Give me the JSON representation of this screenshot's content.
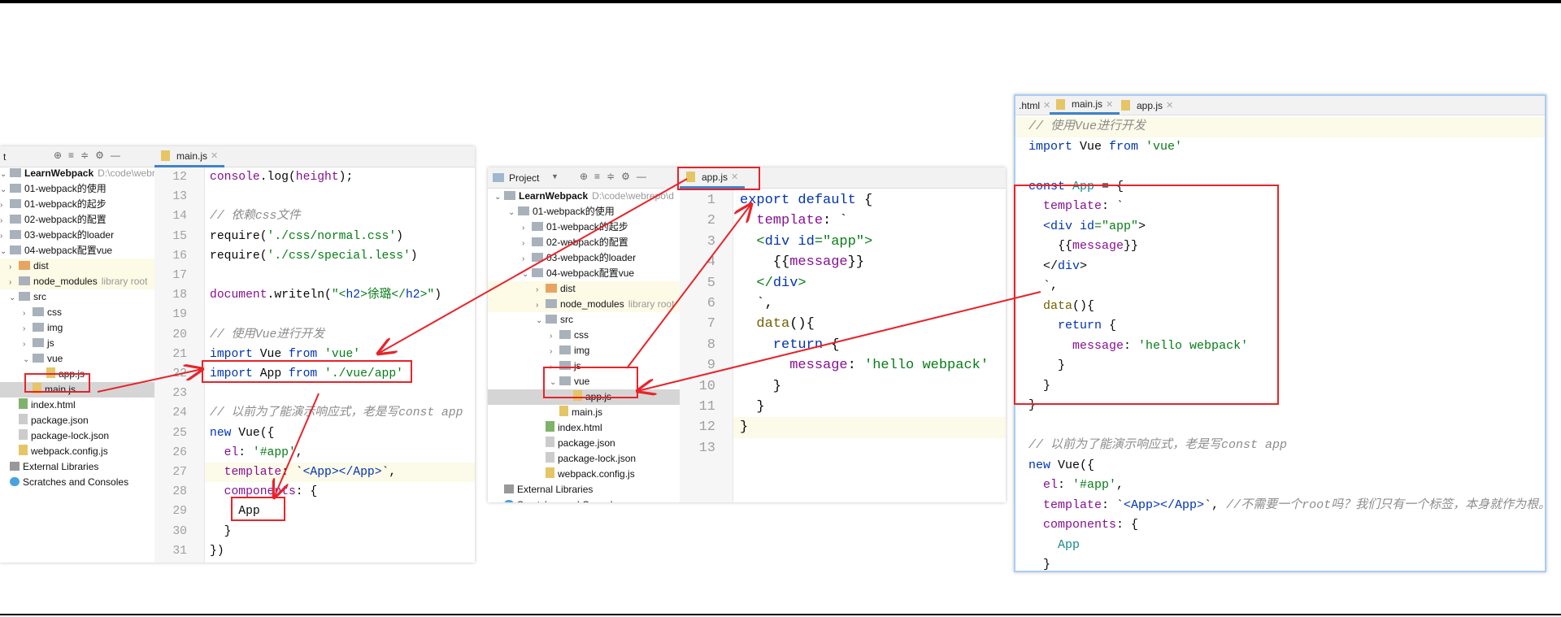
{
  "colors": {
    "annotation": "#e8232a",
    "keyword": "#0033b3",
    "string": "#067d17",
    "property": "#871094",
    "comment": "#8c8c8c"
  },
  "panel1": {
    "toolbar_label": "t",
    "tab": "main.js",
    "tree": [
      {
        "label": "LearnWebpack",
        "extra": "D:\\code\\webrepo\\d",
        "d": 0,
        "a": "v",
        "i": "folder",
        "bold": true
      },
      {
        "label": "01-webpack的使用",
        "d": 1,
        "a": "v",
        "i": "folder"
      },
      {
        "label": "01-webpack的起步",
        "d": 2,
        "a": ">",
        "i": "folder"
      },
      {
        "label": "02-webpack的配置",
        "d": 2,
        "a": ">",
        "i": "folder"
      },
      {
        "label": "03-webpack的loader",
        "d": 2,
        "a": ">",
        "i": "folder"
      },
      {
        "label": "04-webpack配置vue",
        "d": 2,
        "a": "v",
        "i": "folder"
      },
      {
        "label": "dist",
        "d": 3,
        "a": ">",
        "i": "orange",
        "hl": true
      },
      {
        "label": "node_modules",
        "extra": "library root",
        "d": 3,
        "a": ">",
        "i": "folder",
        "hl": true
      },
      {
        "label": "src",
        "d": 3,
        "a": "v",
        "i": "folder"
      },
      {
        "label": "css",
        "d": 4,
        "a": ">",
        "i": "folder"
      },
      {
        "label": "img",
        "d": 4,
        "a": ">",
        "i": "folder"
      },
      {
        "label": "js",
        "d": 4,
        "a": ">",
        "i": "folder"
      },
      {
        "label": "vue",
        "d": 4,
        "a": "v",
        "i": "folder"
      },
      {
        "label": "app.js",
        "d": 5,
        "a": "",
        "i": "js"
      },
      {
        "label": "main.js",
        "d": 4,
        "a": "",
        "i": "js",
        "sel": true
      },
      {
        "label": "index.html",
        "d": 3,
        "a": "",
        "i": "html"
      },
      {
        "label": "package.json",
        "d": 3,
        "a": "",
        "i": "json"
      },
      {
        "label": "package-lock.json",
        "d": 3,
        "a": "",
        "i": "json"
      },
      {
        "label": "webpack.config.js",
        "d": 3,
        "a": "",
        "i": "js"
      },
      {
        "label": "External Libraries",
        "d": 0,
        "a": "",
        "i": "lib"
      },
      {
        "label": "Scratches and Consoles",
        "d": 0,
        "a": "",
        "i": "scr"
      }
    ],
    "lines": [
      {
        "n": "12",
        "t": [
          [
            "console",
            "p"
          ],
          [
            ".log(",
            ""
          ],
          [
            "height",
            "p"
          ],
          [
            ");",
            ""
          ]
        ]
      },
      {
        "n": "13",
        "t": []
      },
      {
        "n": "14",
        "t": [
          [
            "// 依赖css文件",
            "c"
          ]
        ]
      },
      {
        "n": "15",
        "t": [
          [
            "require(",
            ""
          ],
          [
            "'./css/normal.css'",
            "s"
          ],
          [
            ")",
            ""
          ]
        ]
      },
      {
        "n": "16",
        "t": [
          [
            "require(",
            ""
          ],
          [
            "'./css/special.less'",
            "s"
          ],
          [
            ")",
            ""
          ]
        ]
      },
      {
        "n": "17",
        "t": []
      },
      {
        "n": "18",
        "t": [
          [
            "document",
            "p"
          ],
          [
            ".writeln(",
            ""
          ],
          [
            "\"<",
            "s"
          ],
          [
            "h2",
            "k"
          ],
          [
            ">徐璐</",
            "s"
          ],
          [
            "h2",
            "k"
          ],
          [
            ">\"",
            "s"
          ],
          [
            ")",
            ""
          ]
        ]
      },
      {
        "n": "19",
        "t": []
      },
      {
        "n": "20",
        "t": [
          [
            "// 使用Vue进行开发",
            "c"
          ]
        ]
      },
      {
        "n": "21",
        "t": [
          [
            "import ",
            "k"
          ],
          [
            "Vue ",
            ""
          ],
          [
            "from ",
            "k"
          ],
          [
            "'vue'",
            "s"
          ]
        ]
      },
      {
        "n": "22",
        "t": [
          [
            "import ",
            "k"
          ],
          [
            "App ",
            ""
          ],
          [
            "from ",
            "k"
          ],
          [
            "'./vue/app'",
            "s"
          ]
        ]
      },
      {
        "n": "23",
        "t": []
      },
      {
        "n": "24",
        "t": [
          [
            "// 以前为了能演示响应式，老是写const app",
            "c"
          ]
        ]
      },
      {
        "n": "25",
        "t": [
          [
            "new ",
            "k"
          ],
          [
            "Vue({",
            ""
          ]
        ]
      },
      {
        "n": "26",
        "t": [
          [
            "  el",
            "p"
          ],
          [
            ": ",
            ""
          ],
          [
            "'#app'",
            "s"
          ],
          [
            ",",
            ""
          ]
        ]
      },
      {
        "n": "27",
        "hl": true,
        "t": [
          [
            "  template",
            "p"
          ],
          [
            ": `",
            ""
          ],
          [
            "<App></App>",
            "k"
          ],
          [
            "`,",
            ""
          ]
        ]
      },
      {
        "n": "28",
        "t": [
          [
            "  components",
            "p"
          ],
          [
            ": {",
            ""
          ]
        ]
      },
      {
        "n": "29",
        "t": [
          [
            "    App",
            ""
          ]
        ]
      },
      {
        "n": "30",
        "t": [
          [
            "  }",
            ""
          ]
        ]
      },
      {
        "n": "31",
        "t": [
          [
            "})",
            ""
          ]
        ]
      }
    ]
  },
  "panel2": {
    "toolbar_label": "Project",
    "tab": "app.js",
    "tree": [
      {
        "label": "LearnWebpack",
        "extra": "D:\\code\\webrepo\\d",
        "d": 0,
        "a": "v",
        "i": "folder",
        "bold": true
      },
      {
        "label": "01-webpack的使用",
        "d": 1,
        "a": "v",
        "i": "folder"
      },
      {
        "label": "01-webpack的起步",
        "d": 2,
        "a": ">",
        "i": "folder"
      },
      {
        "label": "02-webpack的配置",
        "d": 2,
        "a": ">",
        "i": "folder"
      },
      {
        "label": "03-webpack的loader",
        "d": 2,
        "a": ">",
        "i": "folder"
      },
      {
        "label": "04-webpack配置vue",
        "d": 2,
        "a": "v",
        "i": "folder"
      },
      {
        "label": "dist",
        "d": 3,
        "a": ">",
        "i": "orange",
        "hl": true
      },
      {
        "label": "node_modules",
        "extra": "library root",
        "d": 3,
        "a": ">",
        "i": "folder",
        "hl": true
      },
      {
        "label": "src",
        "d": 3,
        "a": "v",
        "i": "folder"
      },
      {
        "label": "css",
        "d": 4,
        "a": ">",
        "i": "folder"
      },
      {
        "label": "img",
        "d": 4,
        "a": ">",
        "i": "folder"
      },
      {
        "label": "js",
        "d": 4,
        "a": ">",
        "i": "folder"
      },
      {
        "label": "vue",
        "d": 4,
        "a": "v",
        "i": "folder"
      },
      {
        "label": "app.js",
        "d": 5,
        "a": "",
        "i": "js",
        "sel": true
      },
      {
        "label": "main.js",
        "d": 4,
        "a": "",
        "i": "js"
      },
      {
        "label": "index.html",
        "d": 3,
        "a": "",
        "i": "html"
      },
      {
        "label": "package.json",
        "d": 3,
        "a": "",
        "i": "json"
      },
      {
        "label": "package-lock.json",
        "d": 3,
        "a": "",
        "i": "json"
      },
      {
        "label": "webpack.config.js",
        "d": 3,
        "a": "",
        "i": "js"
      },
      {
        "label": "External Libraries",
        "d": 0,
        "a": "",
        "i": "lib"
      },
      {
        "label": "Scratches and Consoles",
        "d": 0,
        "a": "",
        "i": "scr"
      }
    ],
    "lines": [
      {
        "n": "1",
        "t": [
          [
            "export default ",
            "k"
          ],
          [
            "{",
            ""
          ]
        ]
      },
      {
        "n": "2",
        "t": [
          [
            "  template",
            "p"
          ],
          [
            ": `",
            ""
          ]
        ]
      },
      {
        "n": "3",
        "t": [
          [
            "  <",
            "s"
          ],
          [
            "div ",
            "k"
          ],
          [
            "id",
            "k"
          ],
          [
            "=\"app\">",
            "s"
          ]
        ]
      },
      {
        "n": "4",
        "t": [
          [
            "    {{",
            ""
          ],
          [
            "message",
            "p"
          ],
          [
            "}}",
            ""
          ]
        ]
      },
      {
        "n": "5",
        "t": [
          [
            "  </",
            "s"
          ],
          [
            "div",
            "k"
          ],
          [
            ">",
            "s"
          ]
        ]
      },
      {
        "n": "6",
        "t": [
          [
            "  `,",
            ""
          ]
        ]
      },
      {
        "n": "7",
        "t": [
          [
            "  data",
            "d"
          ],
          [
            "(){",
            ""
          ]
        ]
      },
      {
        "n": "8",
        "t": [
          [
            "    return ",
            "k"
          ],
          [
            "{",
            ""
          ]
        ]
      },
      {
        "n": "9",
        "t": [
          [
            "      message",
            "p"
          ],
          [
            ": ",
            ""
          ],
          [
            "'hello webpack'",
            "s"
          ]
        ]
      },
      {
        "n": "10",
        "t": [
          [
            "    }",
            ""
          ]
        ]
      },
      {
        "n": "11",
        "t": [
          [
            "  }",
            ""
          ]
        ]
      },
      {
        "n": "12",
        "hl": true,
        "t": [
          [
            "}",
            ""
          ]
        ]
      },
      {
        "n": "13",
        "t": []
      }
    ]
  },
  "panel3": {
    "tabs": [
      {
        "label": ".html"
      },
      {
        "label": "main.js",
        "active": true
      },
      {
        "label": "app.js"
      }
    ],
    "lines": [
      {
        "hl": true,
        "t": [
          [
            "// 使用Vue进行开发",
            "c"
          ]
        ]
      },
      {
        "t": [
          [
            "import ",
            "k"
          ],
          [
            "Vue ",
            ""
          ],
          [
            "from ",
            "k"
          ],
          [
            "'vue'",
            "s"
          ]
        ]
      },
      {
        "t": []
      },
      {
        "t": [
          [
            "const ",
            "k"
          ],
          [
            "App",
            "a"
          ],
          [
            " = {",
            ""
          ]
        ]
      },
      {
        "t": [
          [
            "  template",
            "p"
          ],
          [
            ": `",
            ""
          ]
        ]
      },
      {
        "t": [
          [
            "  <div ",
            "k"
          ],
          [
            "id",
            "k"
          ],
          [
            "=\"app\"",
            "s"
          ],
          [
            ">",
            ""
          ]
        ]
      },
      {
        "t": [
          [
            "    {{",
            ""
          ],
          [
            "message",
            "p"
          ],
          [
            "}}",
            ""
          ]
        ]
      },
      {
        "t": [
          [
            "  </",
            ""
          ],
          [
            "div",
            "k"
          ],
          [
            ">",
            ""
          ]
        ]
      },
      {
        "t": [
          [
            "  `,",
            ""
          ]
        ]
      },
      {
        "t": [
          [
            "  data",
            "d"
          ],
          [
            "(){",
            ""
          ]
        ]
      },
      {
        "t": [
          [
            "    return ",
            "k"
          ],
          [
            "{",
            ""
          ]
        ]
      },
      {
        "t": [
          [
            "      message",
            "p"
          ],
          [
            ": ",
            ""
          ],
          [
            "'hello webpack'",
            "s"
          ]
        ]
      },
      {
        "t": [
          [
            "    }",
            ""
          ]
        ]
      },
      {
        "t": [
          [
            "  }",
            ""
          ]
        ]
      },
      {
        "t": [
          [
            "}",
            ""
          ]
        ]
      },
      {
        "t": []
      },
      {
        "t": [
          [
            "// 以前为了能演示响应式，老是写const app",
            "c"
          ]
        ]
      },
      {
        "t": [
          [
            "new ",
            "k"
          ],
          [
            "Vue({",
            ""
          ]
        ]
      },
      {
        "t": [
          [
            "  el",
            "p"
          ],
          [
            ": ",
            ""
          ],
          [
            "'#app'",
            "s"
          ],
          [
            ",",
            ""
          ]
        ]
      },
      {
        "t": [
          [
            "  template",
            "p"
          ],
          [
            ": `",
            ""
          ],
          [
            "<App></App>",
            "k"
          ],
          [
            "`, ",
            ""
          ],
          [
            "//不需要一个root吗？我们只有一个标签，本身就作为根。",
            "c"
          ]
        ]
      },
      {
        "t": [
          [
            "  components",
            "p"
          ],
          [
            ": {",
            ""
          ]
        ]
      },
      {
        "t": [
          [
            "    App",
            "a"
          ]
        ]
      },
      {
        "t": [
          [
            "  }",
            ""
          ]
        ]
      },
      {
        "t": [
          [
            "})",
            ""
          ]
        ]
      }
    ]
  }
}
